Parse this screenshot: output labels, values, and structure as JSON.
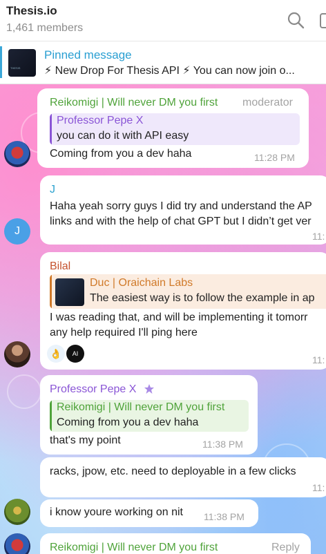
{
  "header": {
    "title": "Thesis.io",
    "members": "1,461 members"
  },
  "pinned": {
    "label": "Pinned message",
    "text": "⚡ New Drop For Thesis API ⚡ You can now join o..."
  },
  "messages": [
    {
      "sender": "Reikomigi | Will never DM you first",
      "role": "moderator",
      "reply_to": {
        "name": "Professor Pepe X",
        "text": "you can do it with API easy"
      },
      "text": "Coming from you a dev haha",
      "time": "11:28 PM"
    },
    {
      "sender": "J",
      "avatar_letter": "J",
      "text_lines": [
        "Haha yeah sorry guys I did try and understand the AP",
        "links and with the help of chat GPT but I didn’t get ver"
      ],
      "time": "11:"
    },
    {
      "sender": "Bilal",
      "reply_to": {
        "name": "Duc | Oraichain Labs",
        "text": "The easiest way is to follow the example in ap"
      },
      "text_lines": [
        "I was reading that, and will be implementing it tomorr",
        "any help required I'll ping here"
      ],
      "reactions": [
        "👌",
        "AI"
      ],
      "time": "11:"
    },
    {
      "sender": "Professor Pepe X",
      "reply_to": {
        "name": "Reikomigi | Will never DM you first",
        "text": "Coming from you a dev haha"
      },
      "text": "that's my point",
      "time": "11:38 PM"
    },
    {
      "text": "racks, jpow, etc. need to deployable in a few clicks",
      "time": "11:"
    },
    {
      "text": "i know youre working on nit",
      "time": "11:38 PM"
    },
    {
      "sender": "Reikomigi | Will never DM you first",
      "action": "Reply"
    }
  ],
  "colors": {
    "reikomigi": "#4fa33a",
    "pepe": "#8a55d6",
    "j": "#2ea3cf",
    "bilal": "#c5532f",
    "duc": "#d07a2a",
    "accent": "#2a9fd2"
  }
}
